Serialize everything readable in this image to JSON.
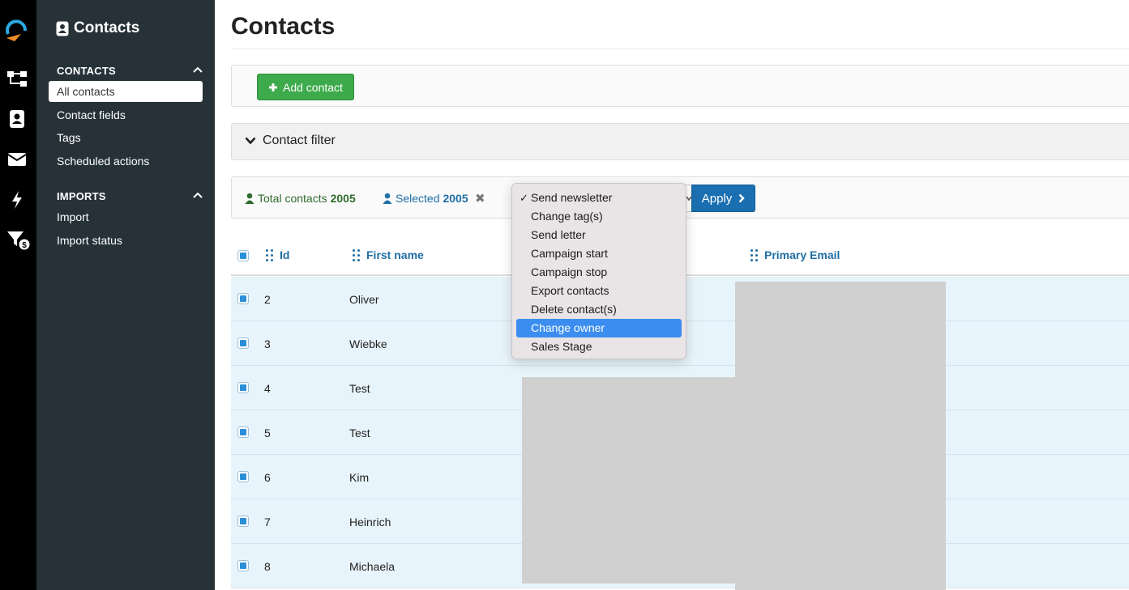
{
  "app": {
    "title": "Contacts"
  },
  "icons": [
    "logo-icon",
    "flow-icon",
    "contact-card-icon",
    "envelope-icon",
    "bolt-icon",
    "filter-dollar-icon"
  ],
  "sidebar": {
    "title": "Contacts",
    "sections": [
      {
        "label": "CONTACTS",
        "items": [
          "All contacts",
          "Contact fields",
          "Tags",
          "Scheduled actions"
        ]
      },
      {
        "label": "IMPORTS",
        "items": [
          "Import",
          "Import status"
        ]
      }
    ]
  },
  "page": {
    "title": "Contacts"
  },
  "toolbar": {
    "add_contact": "Add contact"
  },
  "filter": {
    "label": "Contact filter"
  },
  "stats": {
    "total_label": "Total contacts",
    "total_value": "2005",
    "selected_label": "Selected",
    "selected_value": "2005"
  },
  "action": {
    "apply_label": "Apply"
  },
  "dropdown": {
    "checked": "Send newsletter",
    "highlighted": "Change owner",
    "options": [
      "Send newsletter",
      "Change tag(s)",
      "Send letter",
      "Campaign start",
      "Campaign stop",
      "Export contacts",
      "Delete contact(s)",
      "Change owner",
      "Sales Stage"
    ]
  },
  "table": {
    "columns": [
      "Id",
      "First name",
      "Primary Email"
    ],
    "rows": [
      {
        "id": "2",
        "first_name": "Oliver"
      },
      {
        "id": "3",
        "first_name": "Wiebke"
      },
      {
        "id": "4",
        "first_name": "Test"
      },
      {
        "id": "5",
        "first_name": "Test"
      },
      {
        "id": "6",
        "first_name": "Kim"
      },
      {
        "id": "7",
        "first_name": "Heinrich"
      },
      {
        "id": "8",
        "first_name": "Michaela"
      }
    ]
  },
  "colors": {
    "accent": "#1a6fb0",
    "success": "#3daa4b",
    "sidebar": "#263238",
    "row_bg": "#e8f4fb",
    "highlight": "#3b8eef"
  }
}
